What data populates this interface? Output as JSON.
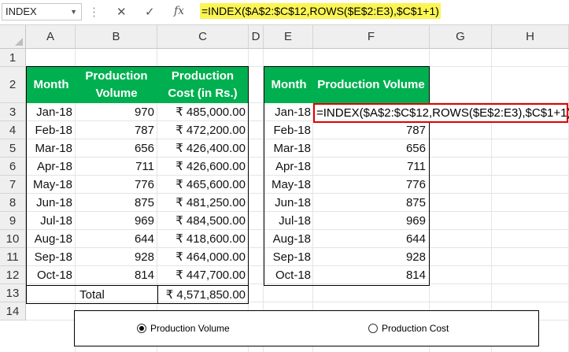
{
  "formula_bar": {
    "name_box": "INDEX",
    "cancel_icon": "✕",
    "enter_icon": "✓",
    "fx_icon": "fx",
    "formula": "=INDEX($A$2:$C$12,ROWS($E$2:E3),$C$1+1)"
  },
  "columns": [
    "A",
    "B",
    "C",
    "D",
    "E",
    "F",
    "G",
    "H"
  ],
  "rows": [
    "1",
    "2",
    "3",
    "4",
    "5",
    "6",
    "7",
    "8",
    "9",
    "10",
    "11",
    "12",
    "13",
    "14"
  ],
  "table1": {
    "headers": [
      "Month",
      "Production Volume",
      "Production Cost (in Rs.)"
    ],
    "rows": [
      {
        "month": "Jan-18",
        "volume": "970",
        "cost": "₹ 485,000.00"
      },
      {
        "month": "Feb-18",
        "volume": "787",
        "cost": "₹ 472,200.00"
      },
      {
        "month": "Mar-18",
        "volume": "656",
        "cost": "₹ 426,400.00"
      },
      {
        "month": "Apr-18",
        "volume": "711",
        "cost": "₹ 426,600.00"
      },
      {
        "month": "May-18",
        "volume": "776",
        "cost": "₹ 465,600.00"
      },
      {
        "month": "Jun-18",
        "volume": "875",
        "cost": "₹ 481,250.00"
      },
      {
        "month": "Jul-18",
        "volume": "969",
        "cost": "₹ 484,500.00"
      },
      {
        "month": "Aug-18",
        "volume": "644",
        "cost": "₹ 418,600.00"
      },
      {
        "month": "Sep-18",
        "volume": "928",
        "cost": "₹ 464,000.00"
      },
      {
        "month": "Oct-18",
        "volume": "814",
        "cost": "₹ 447,700.00"
      }
    ],
    "total_label": "Total",
    "total_value": "₹ 4,571,850.00"
  },
  "table2": {
    "headers": [
      "Month",
      "Production Volume"
    ],
    "editing_formula": "=INDEX($A$2:$C$12,ROWS($E$2:E3),$C$1+1)",
    "rows": [
      {
        "month": "Jan-18",
        "value": ""
      },
      {
        "month": "Feb-18",
        "value": "787"
      },
      {
        "month": "Mar-18",
        "value": "656"
      },
      {
        "month": "Apr-18",
        "value": "711"
      },
      {
        "month": "May-18",
        "value": "776"
      },
      {
        "month": "Jun-18",
        "value": "875"
      },
      {
        "month": "Jul-18",
        "value": "969"
      },
      {
        "month": "Aug-18",
        "value": "644"
      },
      {
        "month": "Sep-18",
        "value": "928"
      },
      {
        "month": "Oct-18",
        "value": "814"
      }
    ]
  },
  "options": [
    {
      "label": "Production Volume",
      "selected": true
    },
    {
      "label": "Production Cost",
      "selected": false
    }
  ]
}
